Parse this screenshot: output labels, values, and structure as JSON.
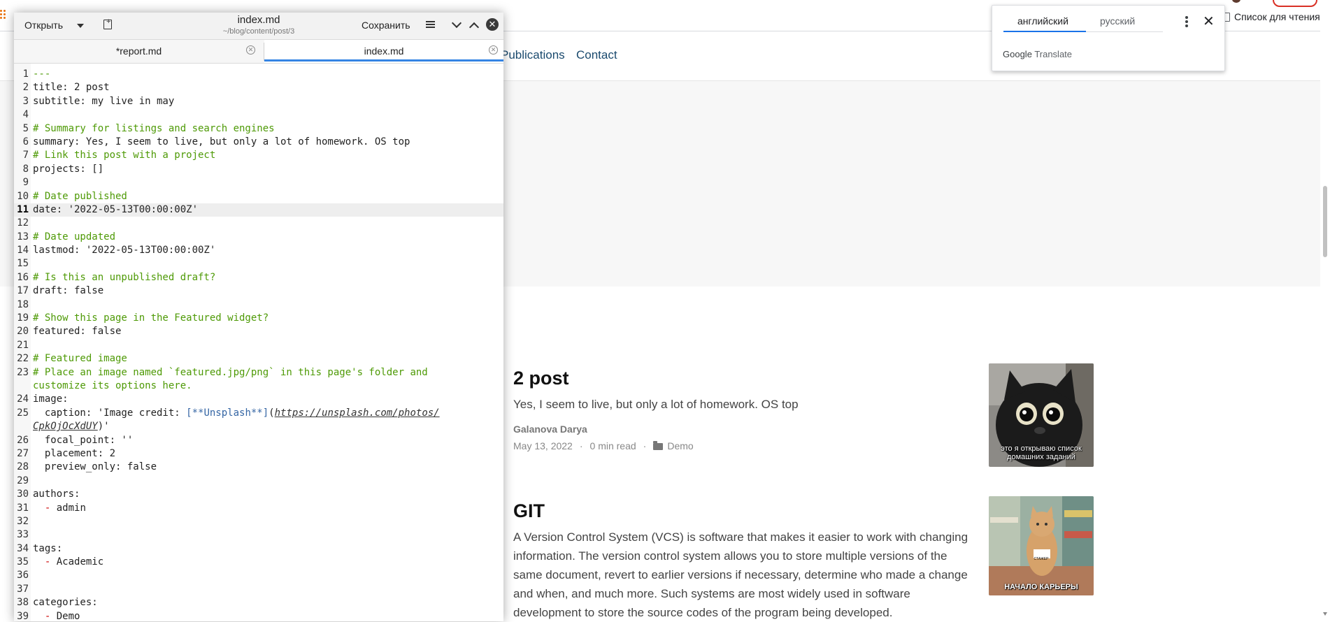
{
  "browser": {
    "reading_list_label": "Список для чтения"
  },
  "site_nav": {
    "items": [
      "Publications",
      "Contact"
    ]
  },
  "translate_popup": {
    "lang_source": "английский",
    "lang_target": "русский",
    "close_glyph": "✕",
    "brand_google": "Google",
    "brand_translate": "Translate"
  },
  "posts": [
    {
      "title": "2 post",
      "summary": "Yes, I seem to live, but only a lot of homework. OS top",
      "author": "Galanova Darya",
      "date": "May 13, 2022",
      "read_time": "0 min read",
      "category": "Demo",
      "image_caption": "это я открываю список домашних заданий"
    },
    {
      "title": "GIT",
      "summary": "A Version Control System (VCS) is software that makes it easier to work with changing information. The version control system allows you to store multiple versions of the same document, revert to earlier versions if necessary, determine who made a change and when, and much more. Such systems are most widely used in software development to store the source codes of the program being developed.",
      "image_caption": "НАЧАЛО КАРЬЕРЫ",
      "image_badge": "СТАЖЕР"
    }
  ],
  "editor": {
    "open_label": "Открыть",
    "title": "index.md",
    "subtitle": "~/blog/content/post/3",
    "save_label": "Сохранить",
    "close_glyph": "✕",
    "tabs": [
      {
        "label": "*report.md",
        "active": false
      },
      {
        "label": "index.md",
        "active": true
      }
    ],
    "current_line": 11,
    "lines": [
      {
        "n": "1",
        "t": "---"
      },
      {
        "n": "2",
        "t": "title: 2 post"
      },
      {
        "n": "3",
        "t": "subtitle: my live in may"
      },
      {
        "n": "4",
        "t": ""
      },
      {
        "n": "5",
        "t": "# Summary for listings and search engines"
      },
      {
        "n": "6",
        "t": "summary: Yes, I seem to live, but only a lot of homework. OS top"
      },
      {
        "n": "7",
        "t": "# Link this post with a project"
      },
      {
        "n": "8",
        "t": "projects: []"
      },
      {
        "n": "9",
        "t": ""
      },
      {
        "n": "10",
        "t": "# Date published"
      },
      {
        "n": "11",
        "t": "date: '2022-05-13T00:00:00Z'"
      },
      {
        "n": "12",
        "t": ""
      },
      {
        "n": "13",
        "t": "# Date updated"
      },
      {
        "n": "14",
        "t": "lastmod: '2022-05-13T00:00:00Z'"
      },
      {
        "n": "15",
        "t": ""
      },
      {
        "n": "16",
        "t": "# Is this an unpublished draft?"
      },
      {
        "n": "17",
        "t": "draft: false"
      },
      {
        "n": "18",
        "t": ""
      },
      {
        "n": "19",
        "t": "# Show this page in the Featured widget?"
      },
      {
        "n": "20",
        "t": "featured: false"
      },
      {
        "n": "21",
        "t": ""
      },
      {
        "n": "22",
        "t": "# Featured image"
      },
      {
        "n": "23",
        "t": "# Place an image named `featured.jpg/png` in this page's folder and",
        "t2": "customize its options here."
      },
      {
        "n": "24",
        "t": "image:"
      },
      {
        "n": "25",
        "t": "  caption: 'Image credit: [**Unsplash**](https://unsplash.com/photos/",
        "t2": "CpkOjOcXdUY)'"
      },
      {
        "n": "26",
        "t": "  focal_point: ''"
      },
      {
        "n": "27",
        "t": "  placement: 2"
      },
      {
        "n": "28",
        "t": "  preview_only: false"
      },
      {
        "n": "29",
        "t": ""
      },
      {
        "n": "30",
        "t": "authors:"
      },
      {
        "n": "31",
        "t": "  - admin"
      },
      {
        "n": "32",
        "t": ""
      },
      {
        "n": "33",
        "t": ""
      },
      {
        "n": "34",
        "t": "tags:"
      },
      {
        "n": "35",
        "t": "  - Academic"
      },
      {
        "n": "36",
        "t": ""
      },
      {
        "n": "37",
        "t": ""
      },
      {
        "n": "38",
        "t": "categories:"
      },
      {
        "n": "39",
        "t": "  - Demo"
      }
    ]
  }
}
